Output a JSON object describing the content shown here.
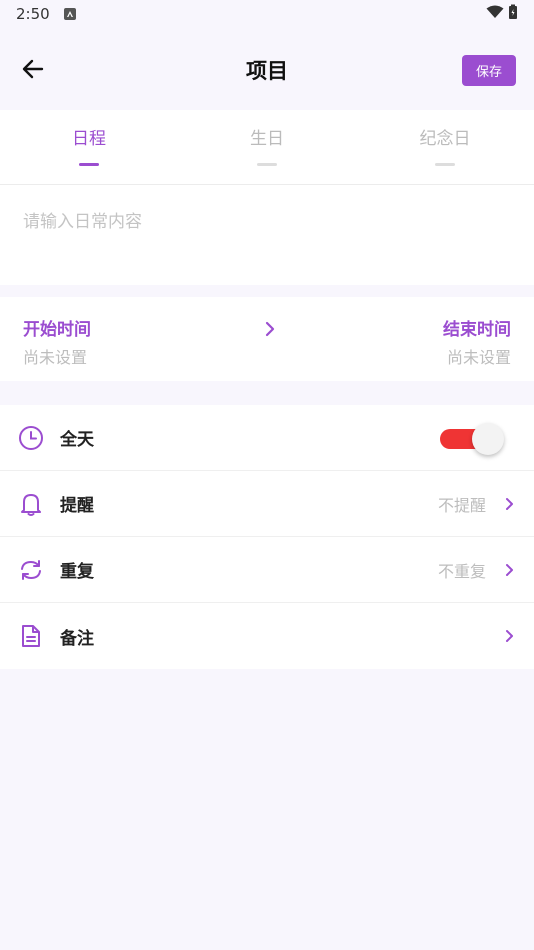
{
  "status_bar": {
    "time": "2:50"
  },
  "header": {
    "title": "项目",
    "save_label": "保存"
  },
  "tabs": [
    {
      "label": "日程",
      "active": true
    },
    {
      "label": "生日",
      "active": false
    },
    {
      "label": "纪念日",
      "active": false
    }
  ],
  "content": {
    "placeholder": "请输入日常内容",
    "value": ""
  },
  "time": {
    "start_label": "开始时间",
    "start_value": "尚未设置",
    "end_label": "结束时间",
    "end_value": "尚未设置"
  },
  "settings": {
    "all_day": {
      "label": "全天",
      "enabled": true
    },
    "reminder": {
      "label": "提醒",
      "value": "不提醒"
    },
    "repeat": {
      "label": "重复",
      "value": "不重复"
    },
    "note": {
      "label": "备注"
    }
  },
  "colors": {
    "accent": "#9b4dd0",
    "toggle_on": "#ef3434",
    "background": "#f8f6fd"
  },
  "icons": {
    "back": "arrow-left-icon",
    "chevron": "chevron-right-icon",
    "all_day": "clock-icon",
    "reminder": "bell-icon",
    "repeat": "refresh-icon",
    "note": "document-icon"
  }
}
